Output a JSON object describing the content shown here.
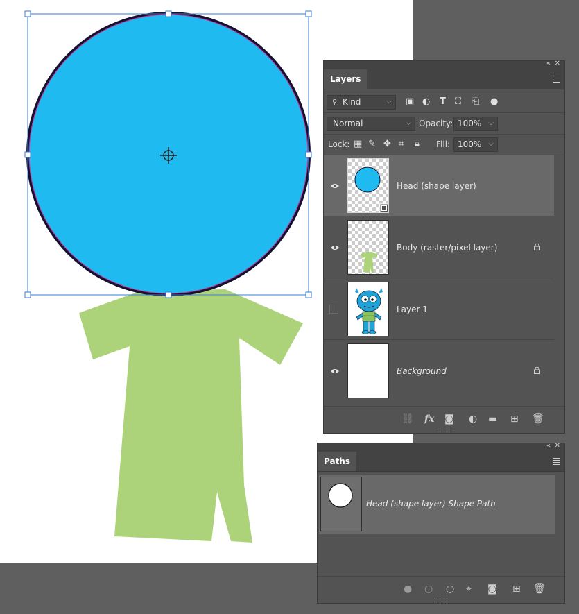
{
  "layers_panel": {
    "tab": "Layers",
    "filter": {
      "label": "Kind"
    },
    "blend": {
      "mode": "Normal",
      "opacity_label": "Opacity:",
      "opacity_value": "100%"
    },
    "lock": {
      "label": "Lock:",
      "fill_label": "Fill:",
      "fill_value": "100%"
    },
    "layers": [
      {
        "name": "Head (shape layer)",
        "visible": true,
        "selected": true,
        "locked": false,
        "italic": false
      },
      {
        "name": "Body (raster/pixel layer)",
        "visible": true,
        "selected": false,
        "locked": true,
        "italic": false
      },
      {
        "name": "Layer 1",
        "visible": false,
        "selected": false,
        "locked": false,
        "italic": false
      },
      {
        "name": "Background",
        "visible": true,
        "selected": false,
        "locked": true,
        "italic": true
      }
    ]
  },
  "paths_panel": {
    "tab": "Paths",
    "paths": [
      {
        "name": "Head (shape layer) Shape Path",
        "selected": true
      }
    ]
  },
  "colors": {
    "head_fill": "#1fbaf0",
    "body_fill": "#acd37a",
    "selection_blue": "#3a7bd5",
    "path_magenta": "#b43a9b"
  }
}
